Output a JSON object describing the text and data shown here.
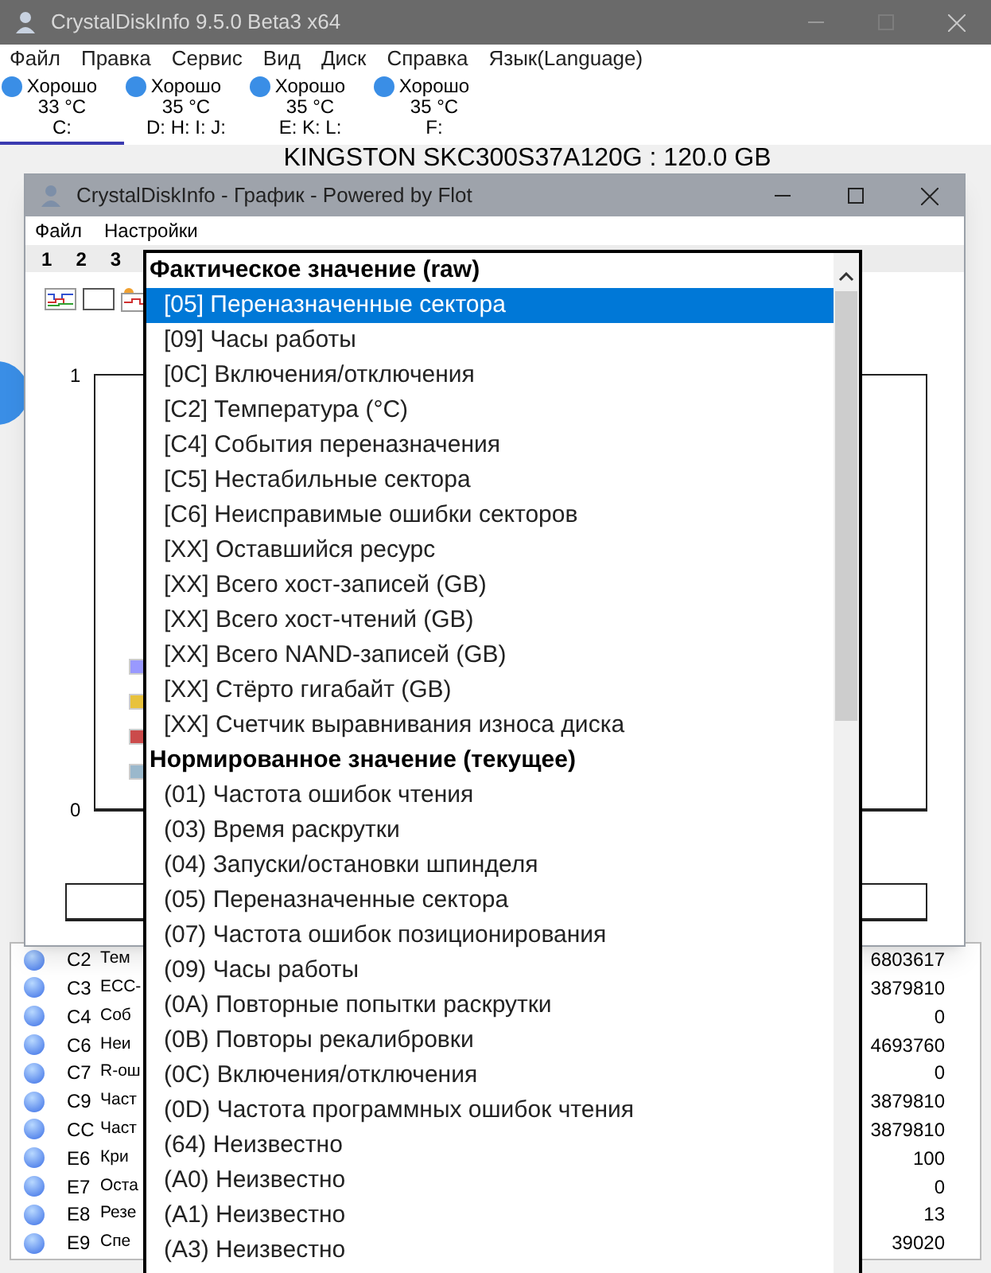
{
  "main_window": {
    "title": "CrystalDiskInfo 9.5.0 Beta3 x64",
    "menu": [
      "Файл",
      "Правка",
      "Сервис",
      "Вид",
      "Диск",
      "Справка",
      "Язык(Language)"
    ],
    "disk_tabs": [
      {
        "status": "Хорошо",
        "temperature": "33 °C",
        "drives": "C:",
        "selected": true,
        "color": "#3a8ee6"
      },
      {
        "status": "Хорошо",
        "temperature": "35 °C",
        "drives": "D: H: I: J:",
        "selected": false,
        "color": "#3a8ee6"
      },
      {
        "status": "Хорошо",
        "temperature": "35 °C",
        "drives": "E: K: L:",
        "selected": false,
        "color": "#3a8ee6"
      },
      {
        "status": "Хорошо",
        "temperature": "35 °C",
        "drives": "F:",
        "selected": false,
        "color": "#3a8ee6"
      }
    ],
    "disk_title": "KINGSTON SKC300S37A120G : 120.0 GB",
    "attributes": [
      {
        "id": "C2",
        "name": "Тем",
        "raw": "6803617"
      },
      {
        "id": "C3",
        "name": "ECC-",
        "raw": "3879810"
      },
      {
        "id": "C4",
        "name": "Соб",
        "raw": "0"
      },
      {
        "id": "C6",
        "name": "Неи",
        "raw": "4693760"
      },
      {
        "id": "C7",
        "name": "R-ош",
        "raw": "0"
      },
      {
        "id": "C9",
        "name": "Част",
        "raw": "3879810"
      },
      {
        "id": "CC",
        "name": "Част",
        "raw": "3879810"
      },
      {
        "id": "E6",
        "name": "Кри",
        "raw": "100"
      },
      {
        "id": "E7",
        "name": "Оста",
        "raw": "0"
      },
      {
        "id": "E8",
        "name": "Резе",
        "raw": "13"
      },
      {
        "id": "E9",
        "name": "Спе",
        "raw": "39020"
      }
    ]
  },
  "graph_window": {
    "title": "CrystalDiskInfo - График - Powered by Flot",
    "menu": [
      "Файл",
      "Настройки"
    ],
    "tabs": [
      "1",
      "2",
      "3"
    ],
    "y_labels": [
      "1",
      "0"
    ],
    "legend": [
      {
        "color": "#9999ff"
      },
      {
        "color": "#e8c23c"
      },
      {
        "color": "#cb4b4b"
      },
      {
        "color": "#9ab8cc"
      }
    ]
  },
  "dropdown": {
    "sections": [
      {
        "title": "Фактическое значение (raw)",
        "items": [
          {
            "label": "[05] Переназначенные сектора",
            "selected": true
          },
          {
            "label": "[09] Часы работы",
            "selected": false
          },
          {
            "label": "[0C] Включения/отключения",
            "selected": false
          },
          {
            "label": "[C2] Температура (°C)",
            "selected": false
          },
          {
            "label": "[C4] События переназначения",
            "selected": false
          },
          {
            "label": "[C5] Нестабильные сектора",
            "selected": false
          },
          {
            "label": "[C6] Неисправимые ошибки секторов",
            "selected": false
          },
          {
            "label": "[XX] Оставшийся ресурс",
            "selected": false
          },
          {
            "label": "[XX] Всего хост-записей (GB)",
            "selected": false
          },
          {
            "label": "[XX] Всего хост-чтений (GB)",
            "selected": false
          },
          {
            "label": "[XX] Всего NAND-записей (GB)",
            "selected": false
          },
          {
            "label": "[XX] Стёрто гигабайт (GB)",
            "selected": false
          },
          {
            "label": "[XX] Счетчик выравнивания износа диска",
            "selected": false
          }
        ]
      },
      {
        "title": "Нормированное значение (текущее)",
        "items": [
          {
            "label": "(01) Частота ошибок чтения",
            "selected": false
          },
          {
            "label": "(03) Время раскрутки",
            "selected": false
          },
          {
            "label": "(04) Запуски/остановки шпинделя",
            "selected": false
          },
          {
            "label": "(05) Переназначенные сектора",
            "selected": false
          },
          {
            "label": "(07) Частота ошибок позиционирования",
            "selected": false
          },
          {
            "label": "(09) Часы работы",
            "selected": false
          },
          {
            "label": "(0A) Повторные попытки раскрутки",
            "selected": false
          },
          {
            "label": "(0B) Повторы рекалибровки",
            "selected": false
          },
          {
            "label": "(0C) Включения/отключения",
            "selected": false
          },
          {
            "label": "(0D) Частота программных ошибок чтения",
            "selected": false
          },
          {
            "label": "(64) Неизвестно",
            "selected": false
          },
          {
            "label": "(A0) Неизвестно",
            "selected": false
          },
          {
            "label": "(A1) Неизвестно",
            "selected": false
          },
          {
            "label": "(A3) Неизвестно",
            "selected": false
          }
        ]
      }
    ]
  }
}
